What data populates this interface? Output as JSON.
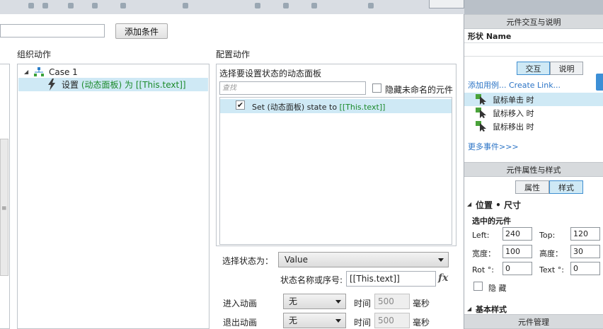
{
  "toolbar": {},
  "conditions": {
    "add_button": "添加条件"
  },
  "organize": {
    "title": "组织动作",
    "case_label": "Case 1",
    "action_prefix": "设置",
    "action_target": "(动态面板) 为 [[This.text]]"
  },
  "configure": {
    "title": "配置动作",
    "subtitle": "选择要设置状态的动态面板",
    "search_placeholder": "查找",
    "hide_unnamed_label": "隐藏未命名的元件",
    "panel_item": {
      "prefix": "Set (动态面板) state to ",
      "value": "[[This.text]]",
      "checked": true
    },
    "select_state_label": "选择状态为：",
    "select_state_value": "Value",
    "state_name_label": "状态名称或序号:",
    "state_name_value": "[[This.text]]",
    "fx_label": "fx",
    "enter_anim_label": "进入动画",
    "exit_anim_label": "退出动画",
    "enter_anim_value": "无",
    "exit_anim_value": "无",
    "time_label": "时间",
    "enter_time_value": "500",
    "exit_time_value": "500",
    "ms_label": "毫秒"
  },
  "inspector": {
    "interaction_header": "元件交互与说明",
    "shape_name": "形状 Name",
    "tab_interaction": "交互",
    "tab_description": "说明",
    "add_case_link": "添加用例... Create Link...",
    "events": [
      {
        "label": "鼠标单击 时",
        "selected": true
      },
      {
        "label": "鼠标移入 时",
        "selected": false
      },
      {
        "label": "鼠标移出 时",
        "selected": false
      }
    ],
    "more_events": "更多事件>>>",
    "props_header": "元件属性与样式",
    "tab_props": "属性",
    "tab_style": "样式",
    "position_title": "位置 • 尺寸",
    "selected_title": "选中的元件",
    "left_label": "Left:",
    "left_value": "240",
    "top_label": "Top:",
    "top_value": "120",
    "width_label": "宽度：",
    "width_value": "100",
    "height_label": "高度：",
    "height_value": "30",
    "rot_label": "Rot °:",
    "rot_value": "0",
    "text_rot_label": "Text °:",
    "text_rot_value": "0",
    "hidden_label": "隐 藏",
    "basic_style": "基本样式",
    "manager_header": "元件管理"
  },
  "colors": {
    "selection": "#cfe9f5",
    "link": "#2a73c5",
    "green_text": "#1b8a2a",
    "accent": "#3c8fd6"
  }
}
